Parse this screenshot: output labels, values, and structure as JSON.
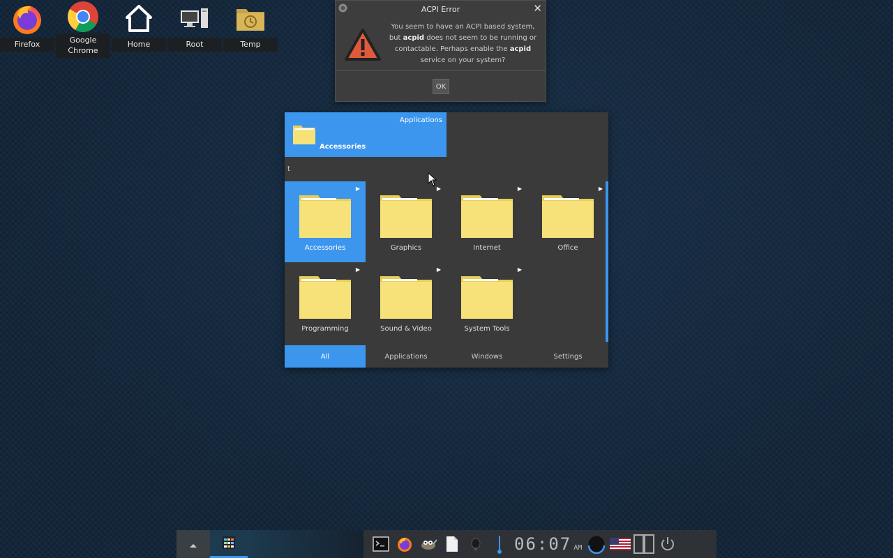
{
  "desktop": {
    "icons": [
      {
        "label": "Firefox",
        "icon": "firefox-icon"
      },
      {
        "label": "Google Chrome",
        "icon": "chrome-icon"
      },
      {
        "label": "Home",
        "icon": "home-icon"
      },
      {
        "label": "Root",
        "icon": "computer-icon"
      },
      {
        "label": "Temp",
        "icon": "folder-clock-icon"
      }
    ]
  },
  "dialog": {
    "title": "ACPI Error",
    "close_label": "✕",
    "message_part1": "You seem to have an ACPI based system, but ",
    "message_bold1": "acpid",
    "message_part2": " does not seem to be running or contactable. Perhaps enable the ",
    "message_bold2": "acpid",
    "message_part3": " service on your system?",
    "ok_label": "OK"
  },
  "menu": {
    "header_category": "Applications",
    "header_selected": "Accessories",
    "search_value": "t",
    "items": [
      {
        "label": "Accessories"
      },
      {
        "label": "Graphics"
      },
      {
        "label": "Internet"
      },
      {
        "label": "Office"
      },
      {
        "label": "Programming"
      },
      {
        "label": "Sound & Video"
      },
      {
        "label": "System Tools"
      }
    ],
    "tabs": [
      {
        "label": "All"
      },
      {
        "label": "Applications"
      },
      {
        "label": "Windows"
      },
      {
        "label": "Settings"
      }
    ]
  },
  "taskbar": {
    "clock_time": "06:07",
    "clock_ampm": "AM"
  },
  "colors": {
    "accent": "#3c96ee",
    "folder": "#f7e27a",
    "warning": "#e05a3a"
  }
}
